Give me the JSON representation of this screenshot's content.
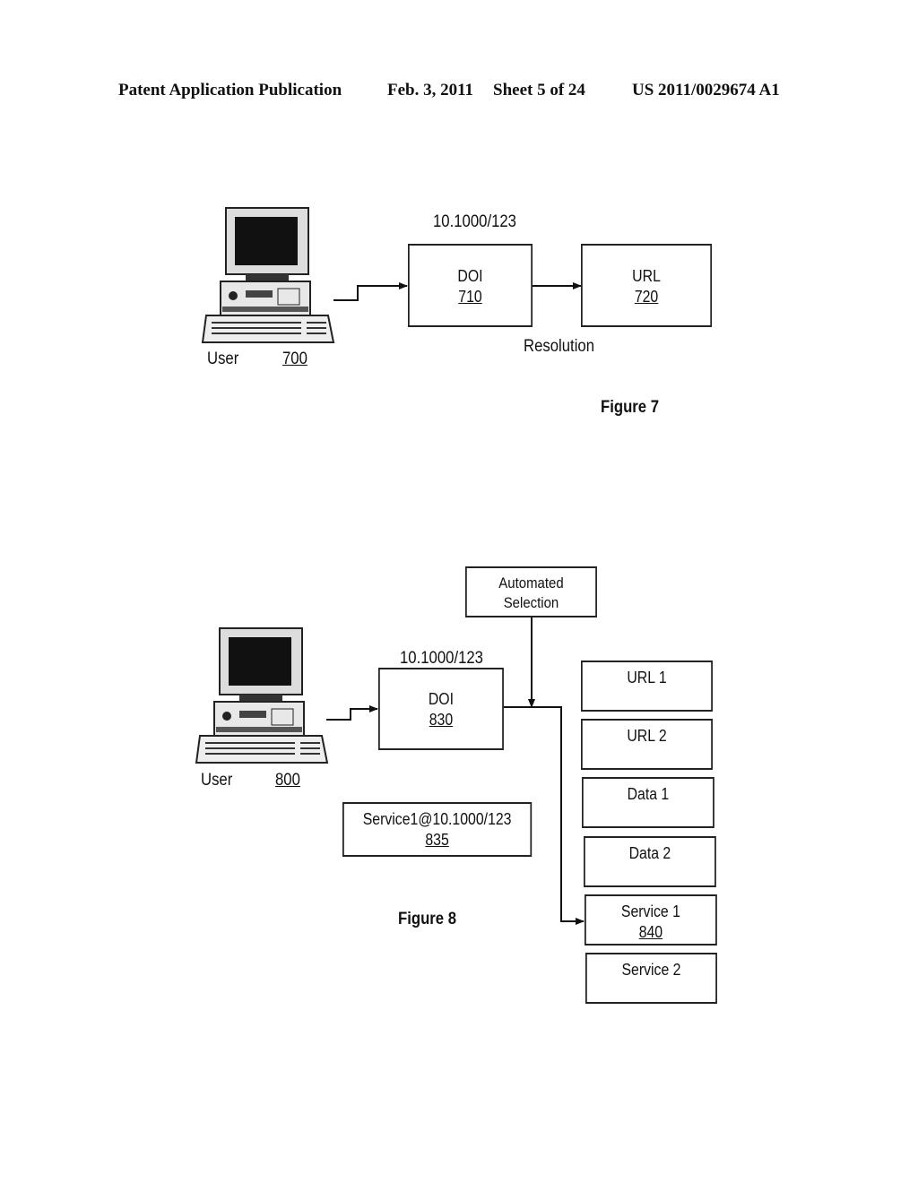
{
  "header": {
    "publication": "Patent Application Publication",
    "date": "Feb. 3, 2011",
    "sheet": "Sheet 5 of 24",
    "number": "US 2011/0029674 A1"
  },
  "figure7": {
    "caption": "Figure 7",
    "user": {
      "label": "User",
      "ref": "700",
      "icon": "desktop-computer-icon"
    },
    "doi_prefix": "10.1000/123",
    "doi_box": {
      "label": "DOI",
      "ref": "710"
    },
    "url_box": {
      "label": "URL",
      "ref": "720"
    },
    "arrow_label": "Resolution"
  },
  "figure8": {
    "caption": "Figure 8",
    "user": {
      "label": "User",
      "ref": "800",
      "icon": "desktop-computer-icon"
    },
    "automated_selection": {
      "line1": "Automated",
      "line2": "Selection"
    },
    "doi_prefix": "10.1000/123",
    "doi_box": {
      "label": "DOI",
      "ref": "830"
    },
    "service_handle": {
      "label": "Service1@10.1000/123",
      "ref": "835"
    },
    "targets": [
      {
        "label": "URL 1",
        "ref": ""
      },
      {
        "label": "URL 2",
        "ref": ""
      },
      {
        "label": "Data 1",
        "ref": ""
      },
      {
        "label": "Data 2",
        "ref": ""
      },
      {
        "label": "Service 1",
        "ref": "840"
      },
      {
        "label": "Service 2",
        "ref": ""
      }
    ]
  }
}
